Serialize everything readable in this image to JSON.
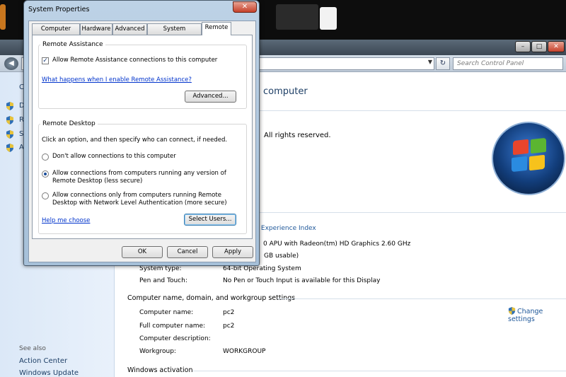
{
  "dialog": {
    "title": "System Properties",
    "close_glyph": "✕",
    "tabs": [
      {
        "label": "Computer Name"
      },
      {
        "label": "Hardware"
      },
      {
        "label": "Advanced"
      },
      {
        "label": "System Protection"
      },
      {
        "label": "Remote"
      }
    ],
    "active_tab": "Remote",
    "remote_assistance": {
      "group_title": "Remote Assistance",
      "allow_label": "Allow Remote Assistance connections to this computer",
      "allow_checked": true,
      "help_link": "What happens when I enable Remote Assistance?",
      "advanced_button": "Advanced..."
    },
    "remote_desktop": {
      "group_title": "Remote Desktop",
      "instruction": "Click an option, and then specify who can connect, if needed.",
      "options": [
        {
          "line1": "Don't allow connections to this computer",
          "line2": "",
          "selected": false
        },
        {
          "line1": "Allow connections from computers running any version of",
          "line2": "Remote Desktop (less secure)",
          "selected": true
        },
        {
          "line1": "Allow connections only from computers running Remote",
          "line2": "Desktop with Network Level Authentication (more secure)",
          "selected": false
        }
      ],
      "help_link": "Help me choose",
      "select_users_button": "Select Users..."
    },
    "buttons": {
      "ok": "OK",
      "cancel": "Cancel",
      "apply": "Apply"
    }
  },
  "control_panel": {
    "search_placeholder": "Search Control Panel",
    "window_buttons": {
      "minimize": "–",
      "maximize": "□",
      "close": "✕"
    },
    "back_glyph": "◀",
    "dropdown_glyph": "▼",
    "refresh_glyph": "↻",
    "sidebar_fragments": [
      "C",
      "D",
      "R",
      "S",
      "A"
    ],
    "see_also": {
      "label": "See also",
      "links": [
        "Action Center",
        "Windows Update"
      ]
    },
    "heading_fragment": "computer",
    "rights_fragment": "All rights reserved.",
    "wei_link_fragment": "ws Experience Index",
    "processor_fragment": "0 APU with Radeon(tm) HD Graphics   2.60 GHz",
    "memory_fragment": "GB usable)",
    "system_rows": [
      {
        "label": "System type:",
        "value": "64-bit Operating System"
      },
      {
        "label": "Pen and Touch:",
        "value": "No Pen or Touch Input is available for this Display"
      }
    ],
    "name_section": {
      "title": "Computer name, domain, and workgroup settings",
      "change_link": "Change settings",
      "rows": [
        {
          "label": "Computer name:",
          "value": "pc2"
        },
        {
          "label": "Full computer name:",
          "value": "pc2"
        },
        {
          "label": "Computer description:",
          "value": ""
        },
        {
          "label": "Workgroup:",
          "value": "WORKGROUP"
        }
      ]
    },
    "activation_title": "Windows activation"
  }
}
